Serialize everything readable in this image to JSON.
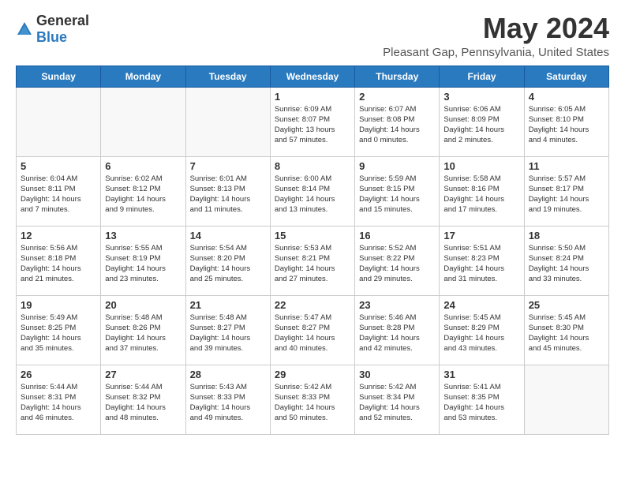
{
  "header": {
    "logo": {
      "text_general": "General",
      "text_blue": "Blue"
    },
    "month_title": "May 2024",
    "location": "Pleasant Gap, Pennsylvania, United States"
  },
  "days_of_week": [
    "Sunday",
    "Monday",
    "Tuesday",
    "Wednesday",
    "Thursday",
    "Friday",
    "Saturday"
  ],
  "weeks": [
    {
      "days": [
        {
          "date": "",
          "content": ""
        },
        {
          "date": "",
          "content": ""
        },
        {
          "date": "",
          "content": ""
        },
        {
          "date": "1",
          "content": "Sunrise: 6:09 AM\nSunset: 8:07 PM\nDaylight: 13 hours\nand 57 minutes."
        },
        {
          "date": "2",
          "content": "Sunrise: 6:07 AM\nSunset: 8:08 PM\nDaylight: 14 hours\nand 0 minutes."
        },
        {
          "date": "3",
          "content": "Sunrise: 6:06 AM\nSunset: 8:09 PM\nDaylight: 14 hours\nand 2 minutes."
        },
        {
          "date": "4",
          "content": "Sunrise: 6:05 AM\nSunset: 8:10 PM\nDaylight: 14 hours\nand 4 minutes."
        }
      ]
    },
    {
      "days": [
        {
          "date": "5",
          "content": "Sunrise: 6:04 AM\nSunset: 8:11 PM\nDaylight: 14 hours\nand 7 minutes."
        },
        {
          "date": "6",
          "content": "Sunrise: 6:02 AM\nSunset: 8:12 PM\nDaylight: 14 hours\nand 9 minutes."
        },
        {
          "date": "7",
          "content": "Sunrise: 6:01 AM\nSunset: 8:13 PM\nDaylight: 14 hours\nand 11 minutes."
        },
        {
          "date": "8",
          "content": "Sunrise: 6:00 AM\nSunset: 8:14 PM\nDaylight: 14 hours\nand 13 minutes."
        },
        {
          "date": "9",
          "content": "Sunrise: 5:59 AM\nSunset: 8:15 PM\nDaylight: 14 hours\nand 15 minutes."
        },
        {
          "date": "10",
          "content": "Sunrise: 5:58 AM\nSunset: 8:16 PM\nDaylight: 14 hours\nand 17 minutes."
        },
        {
          "date": "11",
          "content": "Sunrise: 5:57 AM\nSunset: 8:17 PM\nDaylight: 14 hours\nand 19 minutes."
        }
      ]
    },
    {
      "days": [
        {
          "date": "12",
          "content": "Sunrise: 5:56 AM\nSunset: 8:18 PM\nDaylight: 14 hours\nand 21 minutes."
        },
        {
          "date": "13",
          "content": "Sunrise: 5:55 AM\nSunset: 8:19 PM\nDaylight: 14 hours\nand 23 minutes."
        },
        {
          "date": "14",
          "content": "Sunrise: 5:54 AM\nSunset: 8:20 PM\nDaylight: 14 hours\nand 25 minutes."
        },
        {
          "date": "15",
          "content": "Sunrise: 5:53 AM\nSunset: 8:21 PM\nDaylight: 14 hours\nand 27 minutes."
        },
        {
          "date": "16",
          "content": "Sunrise: 5:52 AM\nSunset: 8:22 PM\nDaylight: 14 hours\nand 29 minutes."
        },
        {
          "date": "17",
          "content": "Sunrise: 5:51 AM\nSunset: 8:23 PM\nDaylight: 14 hours\nand 31 minutes."
        },
        {
          "date": "18",
          "content": "Sunrise: 5:50 AM\nSunset: 8:24 PM\nDaylight: 14 hours\nand 33 minutes."
        }
      ]
    },
    {
      "days": [
        {
          "date": "19",
          "content": "Sunrise: 5:49 AM\nSunset: 8:25 PM\nDaylight: 14 hours\nand 35 minutes."
        },
        {
          "date": "20",
          "content": "Sunrise: 5:48 AM\nSunset: 8:26 PM\nDaylight: 14 hours\nand 37 minutes."
        },
        {
          "date": "21",
          "content": "Sunrise: 5:48 AM\nSunset: 8:27 PM\nDaylight: 14 hours\nand 39 minutes."
        },
        {
          "date": "22",
          "content": "Sunrise: 5:47 AM\nSunset: 8:27 PM\nDaylight: 14 hours\nand 40 minutes."
        },
        {
          "date": "23",
          "content": "Sunrise: 5:46 AM\nSunset: 8:28 PM\nDaylight: 14 hours\nand 42 minutes."
        },
        {
          "date": "24",
          "content": "Sunrise: 5:45 AM\nSunset: 8:29 PM\nDaylight: 14 hours\nand 43 minutes."
        },
        {
          "date": "25",
          "content": "Sunrise: 5:45 AM\nSunset: 8:30 PM\nDaylight: 14 hours\nand 45 minutes."
        }
      ]
    },
    {
      "days": [
        {
          "date": "26",
          "content": "Sunrise: 5:44 AM\nSunset: 8:31 PM\nDaylight: 14 hours\nand 46 minutes."
        },
        {
          "date": "27",
          "content": "Sunrise: 5:44 AM\nSunset: 8:32 PM\nDaylight: 14 hours\nand 48 minutes."
        },
        {
          "date": "28",
          "content": "Sunrise: 5:43 AM\nSunset: 8:33 PM\nDaylight: 14 hours\nand 49 minutes."
        },
        {
          "date": "29",
          "content": "Sunrise: 5:42 AM\nSunset: 8:33 PM\nDaylight: 14 hours\nand 50 minutes."
        },
        {
          "date": "30",
          "content": "Sunrise: 5:42 AM\nSunset: 8:34 PM\nDaylight: 14 hours\nand 52 minutes."
        },
        {
          "date": "31",
          "content": "Sunrise: 5:41 AM\nSunset: 8:35 PM\nDaylight: 14 hours\nand 53 minutes."
        },
        {
          "date": "",
          "content": ""
        }
      ]
    }
  ]
}
